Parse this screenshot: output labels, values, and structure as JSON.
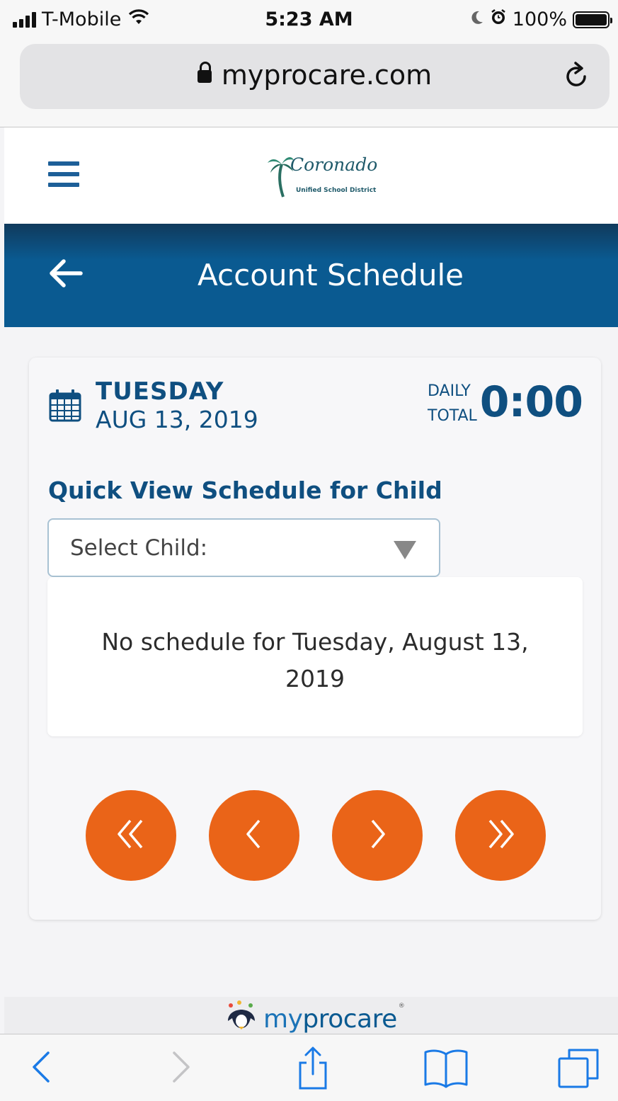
{
  "status_bar": {
    "carrier": "T-Mobile",
    "time": "5:23 AM",
    "battery": "100%"
  },
  "browser": {
    "url": "myprocare.com"
  },
  "header": {
    "logo_script": "Coronado",
    "logo_subtitle": "Unified School District"
  },
  "title_bar": {
    "title": "Account Schedule"
  },
  "schedule": {
    "day": "TUESDAY",
    "date": "AUG 13, 2019",
    "daily_label": "DAILY",
    "total_label": "TOTAL",
    "daily_total": "0:00",
    "quick_view_title": "Quick View Schedule for Child",
    "select_placeholder": "Select Child:",
    "empty_message": "No schedule for Tuesday, August 13, 2019"
  },
  "navigation": {
    "icons": [
      "double-chevron-left-icon",
      "chevron-left-icon",
      "chevron-right-icon",
      "double-chevron-right-icon"
    ]
  },
  "footer": {
    "brand_prefix": "my",
    "brand_suffix": "procare",
    "brand_mark": "®"
  },
  "colors": {
    "primary_blue": "#0f4f80",
    "header_blue": "#0a5a91",
    "accent_orange": "#ea6418",
    "ios_blue": "#1a7ae6"
  }
}
